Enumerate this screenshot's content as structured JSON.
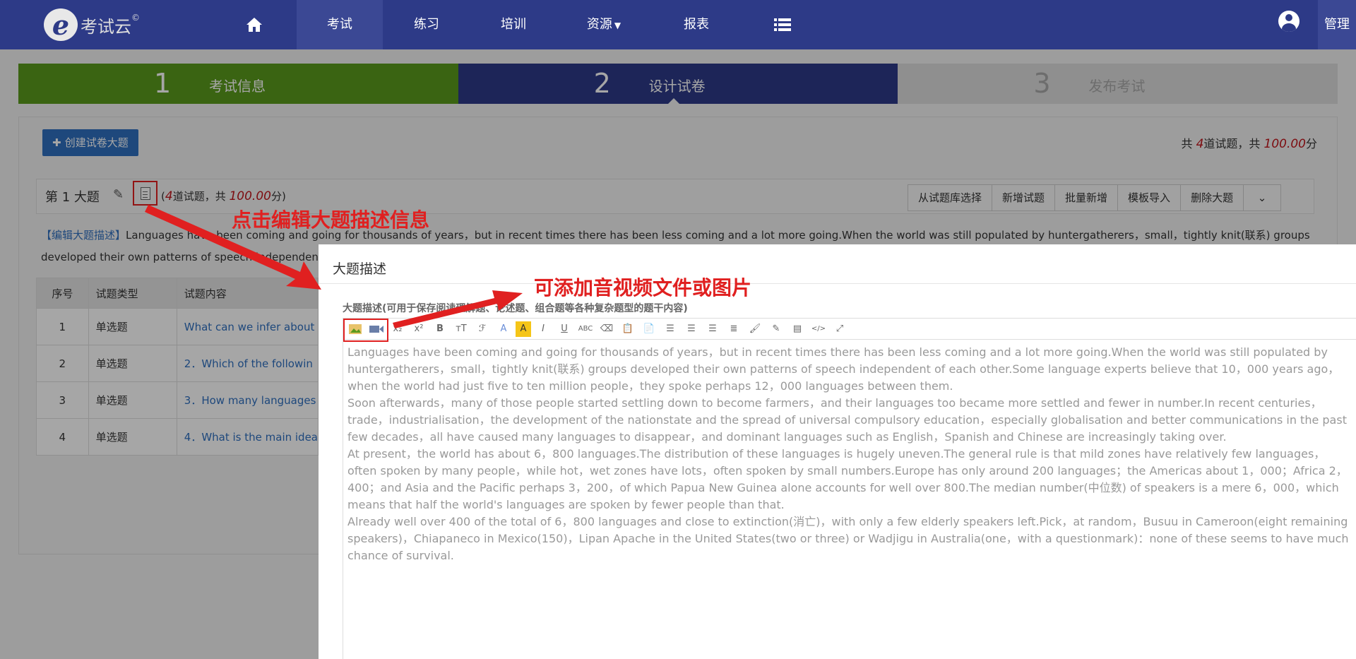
{
  "nav": {
    "logo_text": "考试云",
    "logo_copyright": "©",
    "items": [
      "考试",
      "练习",
      "培训",
      "资源",
      "报表"
    ],
    "manage": "管理"
  },
  "steps": [
    {
      "num": "1",
      "label": "考试信息"
    },
    {
      "num": "2",
      "label": "设计试卷"
    },
    {
      "num": "3",
      "label": "发布考试"
    }
  ],
  "toolbar": {
    "create_btn": "创建试卷大题",
    "summary_pre": "共",
    "summary_count": "4",
    "summary_mid": "道试题，共",
    "summary_score": "100.00",
    "summary_post": "分"
  },
  "section": {
    "title": "第 1 大题",
    "count_pre": "(",
    "count": "4",
    "count_mid": "道试题，共",
    "score": "100.00",
    "count_post": "分)",
    "buttons": [
      "从试题库选择",
      "新增试题",
      "批量新增",
      "模板导入",
      "删除大题"
    ],
    "desc_tag": "【编辑大题描述】",
    "desc_line1": "Languages have been coming and going for thousands of years，but in recent times there has been less coming and a lot more going.When the world was still populated by huntergatherers，small，tightly knit(联系) groups",
    "desc_line2": "developed their own patterns of speech independent o"
  },
  "table": {
    "headers": [
      "序号",
      "试题类型",
      "试题内容"
    ],
    "rows": [
      {
        "num": "1",
        "type": "单选题",
        "content": "What can we infer about"
      },
      {
        "num": "2",
        "type": "单选题",
        "content": "2．Which of the followin"
      },
      {
        "num": "3",
        "type": "单选题",
        "content": "3．How many languages"
      },
      {
        "num": "4",
        "type": "单选题",
        "content": "4．What is the main idea"
      }
    ]
  },
  "modal": {
    "title": "大题描述",
    "label": "大题描述(可用于保存阅读理解题、论述题、组合题等各种复杂题型的题干内容)",
    "text": "Languages have been coming and going for thousands of years，but in recent times there has been less coming and a lot more going.When the world was still populated by huntergatherers，small，tightly knit(联系) groups developed their own patterns of speech independent of each other.Some language experts believe that 10，000 years ago，when the world had just five to ten million people，they spoke perhaps 12，000 languages between them.\nSoon afterwards，many of those people started settling down to become farmers，and their languages too became more settled and fewer in number.In recent centuries，trade，industrialisation，the development of the nationstate and the spread of universal compulsory education，especially globalisation and better communications in the past few decades，all have caused many languages to disappear，and dominant languages such as English，Spanish and Chinese are increasingly taking over.\nAt present，the world has about 6，800 languages.The distribution of these languages is hugely uneven.The general rule is that mild zones have relatively few languages，often spoken by many people，while hot，wet zones have lots，often spoken by small numbers.Europe has only around 200 languages；the Americas about 1，000；Africa 2，400；and Asia and the Pacific perhaps 3，200，of which Papua New Guinea alone accounts for well over 800.The median number(中位数) of speakers is a mere 6，000，which means that half the world's languages are spoken by fewer people than that.\nAlready well over 400 of the total of 6，800 languages and close to extinction(消亡)，with only a few elderly speakers left.Pick，at random，Busuu in Cameroon(eight remaining speakers)，Chiapaneco in Mexico(150)，Lipan Apache in the United States(two or three) or Wadjigu in Australia(one，with a questionmark)：none of these seems to have much chance of survival."
  },
  "annotations": {
    "edit_desc": "点击编辑大题描述信息",
    "add_media": "可添加音视频文件或图片"
  },
  "colors": {
    "nav": "#2d3a87",
    "step1": "#5a9a1c",
    "annotation": "#e02020"
  }
}
